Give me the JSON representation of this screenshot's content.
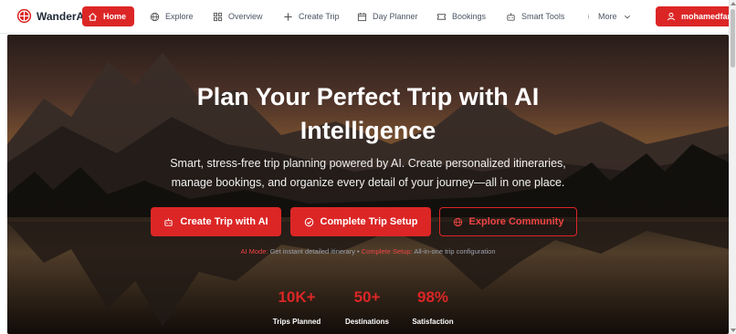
{
  "app": {
    "name": "WanderAI"
  },
  "nav": {
    "items": [
      {
        "label": "Home",
        "icon": "home-icon",
        "active": true
      },
      {
        "label": "Explore",
        "icon": "globe-icon"
      },
      {
        "label": "Overview",
        "icon": "grid-icon"
      },
      {
        "label": "Create Trip",
        "icon": "plus-icon"
      },
      {
        "label": "Day Planner",
        "icon": "calendar-icon"
      },
      {
        "label": "Bookings",
        "icon": "ticket-icon"
      },
      {
        "label": "Smart Tools",
        "icon": "robot-icon"
      },
      {
        "label": "More",
        "icon": "more-icon"
      }
    ],
    "user": {
      "label": "mohamedfarhan",
      "icon": "user-icon"
    }
  },
  "hero": {
    "title_line1": "Plan Your Perfect Trip with AI",
    "title_line2": "Intelligence",
    "subtitle_line1": "Smart, stress-free trip planning powered by AI. Create personalized itineraries,",
    "subtitle_line2": "manage bookings, and organize every detail of your journey—all in one place.",
    "buttons": {
      "create": "Create Trip with AI",
      "setup": "Complete Trip Setup",
      "community": "Explore Community"
    },
    "hint": {
      "ai_mode": "AI Mode:",
      "ai_text": "Get instant detailed itinerary •",
      "setup": "Complete Setup:",
      "setup_text": "All-in-one trip configuration"
    },
    "stats": [
      {
        "value": "10K+",
        "label": "Trips Planned"
      },
      {
        "value": "50+",
        "label": "Destinations"
      },
      {
        "value": "98%",
        "label": "Satisfaction"
      }
    ]
  },
  "colors": {
    "accent": "#dc2626",
    "nav_bg": "#ffffff",
    "text": "#1f2937"
  }
}
